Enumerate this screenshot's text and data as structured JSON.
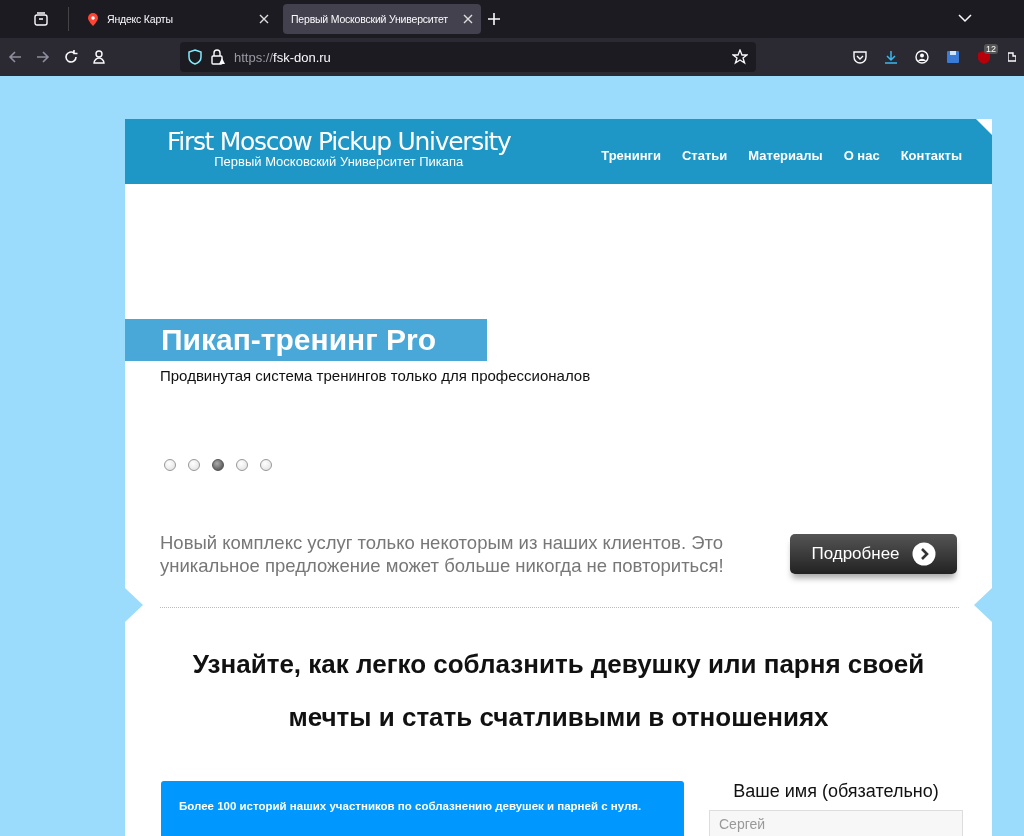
{
  "browser": {
    "tabs": [
      {
        "label": "Яндекс Карты",
        "selected": false
      },
      {
        "label": "Первый Московский Университет",
        "selected": true
      }
    ],
    "url_scheme": "https://",
    "url_host": "fsk-don.ru",
    "extension_badge": "12"
  },
  "header": {
    "logo_title": "First Moscow Pickup University",
    "logo_subtitle": "Первый Московский Университет Пикапа",
    "nav": [
      "Тренинги",
      "Статьи",
      "Материалы",
      "О нас",
      "Контакты"
    ]
  },
  "slider": {
    "title": "Пикап-тренинг Pro",
    "subtitle": "Продвинутая система тренингов только для профессионалов",
    "dots": [
      {
        "selected": false
      },
      {
        "selected": false
      },
      {
        "selected": true
      },
      {
        "selected": false
      },
      {
        "selected": false
      }
    ]
  },
  "promo": {
    "text": "Новый комплекс услуг только некоторым из наших клиентов. Это уникальное предложение может больше никогда не повториться!",
    "button": "Подробнее"
  },
  "headline": "Узнайте, как легко соблазнить девушку или парня своей мечты и стать счатливыми в отношениях",
  "stories_box": {
    "text": "Более 100 историй наших участников по соблазнению девушек и парней с нуля."
  },
  "form": {
    "label": "Ваше имя (обязательно)",
    "name_placeholder": "Сергей"
  }
}
